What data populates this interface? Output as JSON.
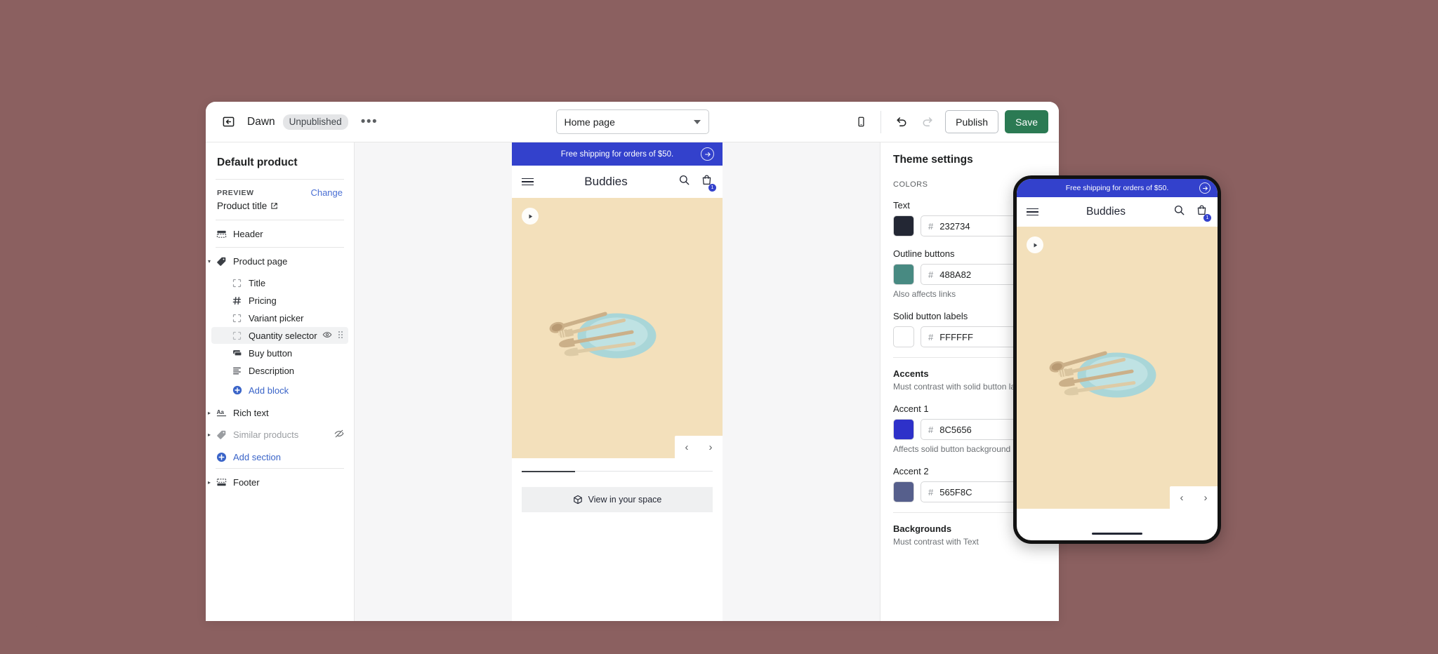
{
  "topbar": {
    "back_icon": "back-arrow-icon",
    "theme_name": "Dawn",
    "status_badge": "Unpublished",
    "more_label": "•••",
    "page_selector": {
      "value": "Home page",
      "chevron": "chevron-down-icon"
    },
    "mobile_icon": "mobile-device-icon",
    "undo_icon": "undo-icon",
    "redo_icon": "redo-icon",
    "publish_label": "Publish",
    "save_label": "Save"
  },
  "sidebar": {
    "title": "Default product",
    "preview": {
      "caption": "PREVIEW",
      "change_label": "Change",
      "value": "Product title",
      "external_icon": "external-link-icon"
    },
    "items": [
      {
        "label": "Header",
        "icon": "header-layout-icon",
        "kind": "section",
        "disclosure": "",
        "muted": false,
        "selected": false
      },
      {
        "label": "Product page",
        "icon": "tag-icon",
        "kind": "section",
        "disclosure": "▾",
        "muted": false,
        "selected": false
      },
      {
        "label": "Title",
        "icon": "block-square-icon",
        "kind": "block",
        "disclosure": "",
        "muted": false,
        "selected": false
      },
      {
        "label": "Pricing",
        "icon": "hash-icon",
        "kind": "block",
        "disclosure": "",
        "muted": false,
        "selected": false
      },
      {
        "label": "Variant picker",
        "icon": "block-square-icon",
        "kind": "block",
        "disclosure": "",
        "muted": false,
        "selected": false
      },
      {
        "label": "Quantity selector",
        "icon": "block-square-icon",
        "kind": "block",
        "disclosure": "",
        "muted": false,
        "selected": true
      },
      {
        "label": "Buy button",
        "icon": "buy-button-icon",
        "kind": "block",
        "disclosure": "",
        "muted": false,
        "selected": false
      },
      {
        "label": "Description",
        "icon": "text-lines-icon",
        "kind": "block",
        "disclosure": "",
        "muted": false,
        "selected": false
      }
    ],
    "selected_actions": {
      "hide_icon": "eye-icon",
      "drag_icon": "drag-handle-icon"
    },
    "add_block_label": "Add block",
    "items_tail": [
      {
        "label": "Rich text",
        "icon": "aa-text-icon",
        "kind": "section",
        "disclosure": "▸",
        "muted": false,
        "hidden_icon": ""
      },
      {
        "label": "Similar products",
        "icon": "tag-icon",
        "kind": "section",
        "disclosure": "▸",
        "muted": true,
        "hidden_icon": "eye-off-icon"
      }
    ],
    "add_section_label": "Add section",
    "footer_item": {
      "label": "Footer",
      "icon": "footer-layout-icon",
      "disclosure": "▸"
    }
  },
  "preview": {
    "announcement": "Free shipping for orders of $50.",
    "announcement_arrow": "arrow-right-icon",
    "menu_icon": "hamburger-menu-icon",
    "store_name": "Buddies",
    "search_icon": "search-icon",
    "cart_icon": "shopping-bag-icon",
    "cart_count": "1",
    "play_icon": "play-icon",
    "prev_label": "‹",
    "next_label": "›",
    "view_space_label": "View in your space",
    "view_space_icon": "cube-icon"
  },
  "settings": {
    "title": "Theme settings",
    "colors_caption": "COLORS",
    "fields": [
      {
        "label": "Text",
        "hex": "232734",
        "swatch": "#232734",
        "helper": ""
      },
      {
        "label": "Outline buttons",
        "hex": "488A82",
        "swatch": "#488A82",
        "helper": "Also affects links"
      },
      {
        "label": "Solid button labels",
        "hex": "FFFFFF",
        "swatch": "#FFFFFF",
        "helper": ""
      }
    ],
    "accents_head": "Accents",
    "accents_helper": "Must contrast with solid button labels",
    "accent_fields": [
      {
        "label": "Accent 1",
        "hex": "8C5656",
        "swatch": "#2E31C9",
        "helper": "Affects solid button background"
      },
      {
        "label": "Accent 2",
        "hex": "565F8C",
        "swatch": "#565F8C",
        "helper": ""
      }
    ],
    "backgrounds_head": "Backgrounds",
    "backgrounds_helper": "Must contrast with Text"
  },
  "colors": {
    "page_bg": "#8B6060",
    "announcement_bg": "#3341CC",
    "save_green": "#2B7A53",
    "link_blue": "#3A64C8",
    "hero_bg": "#F3E0BB"
  }
}
